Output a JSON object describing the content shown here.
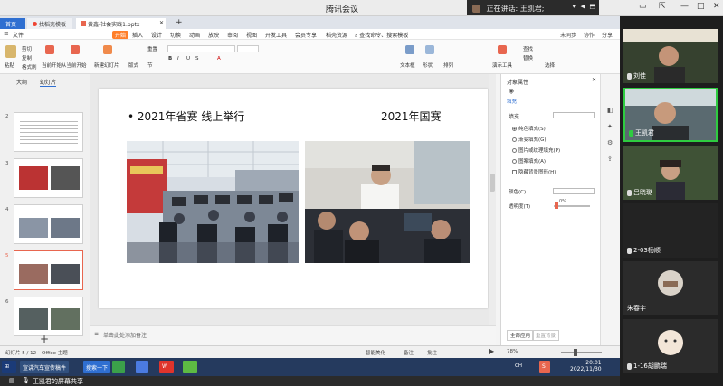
{
  "meeting": {
    "title": "腾讯会议",
    "speaking_label": "正在讲话: 王凯君;"
  },
  "wps": {
    "tabs": {
      "home": "首页",
      "template": "找稻壳模板",
      "doc": "黄鑫-社会实践1.pptx"
    },
    "menu": [
      "文件",
      "开始",
      "插入",
      "设计",
      "切换",
      "动画",
      "放映",
      "审阅",
      "视图",
      "开发工具",
      "会员专享",
      "稻壳资源"
    ],
    "search_hint": "查找命令、搜索模板",
    "menu_right": [
      "未同步",
      "协作",
      "分享"
    ],
    "toolbar_labels": [
      "粘贴",
      "剪切",
      "复制",
      "格式刷",
      "当前开始",
      "从当前开始",
      "新建幻灯片",
      "版式",
      "节",
      "重置",
      "文本框",
      "形状",
      "排列",
      "演示工具",
      "替换",
      "选择",
      "查找"
    ],
    "panel_tabs": [
      "大纲",
      "幻灯片"
    ],
    "slide_numbers": [
      "2",
      "3",
      "4",
      "5",
      "6"
    ],
    "notes_placeholder": "单击此处添加备注",
    "status_left": [
      "幻灯片 5 / 12",
      "Office 主题"
    ],
    "status_right": [
      "智能美化",
      "备注",
      "批注"
    ],
    "zoom": "78%",
    "zoom_percent": 78
  },
  "slide": {
    "bullet": "•",
    "left_title": "2021年省赛 线上举行",
    "right_title": "2021年国赛"
  },
  "property_pane": {
    "title": "对象属性",
    "section": "填充",
    "fill_header": "填充",
    "options": [
      "纯色填充(S)",
      "渐变填充(G)",
      "图片或纹理填充(P)",
      "图案填充(A)",
      "隐藏背景图形(H)"
    ],
    "color_label": "颜色(C)",
    "transparency_label": "透明度(T)",
    "transparency_value": "0%",
    "apply_all": "全部应用",
    "reset_bg": "重置背景"
  },
  "taskbar": {
    "items": [
      "宣讲汽车宣传稿件",
      "搜索一下"
    ],
    "time": "20:01",
    "date": "2022/11/30",
    "lang": "CH"
  },
  "share_bar": {
    "text": "王凯君的屏幕共享"
  },
  "participants": [
    {
      "name": "刘佳"
    },
    {
      "name": "王凯君"
    },
    {
      "name": "吕晓璐"
    },
    {
      "name": "2-03杨顺"
    },
    {
      "name": "朱春宇"
    },
    {
      "name": "1-16胡鹏瑞"
    }
  ],
  "colors": {
    "accent_orange": "#ff7f2a",
    "active_speaker": "#2ecc40",
    "taskbar": "#253a5e",
    "slide_active_border": "#e8664f"
  }
}
